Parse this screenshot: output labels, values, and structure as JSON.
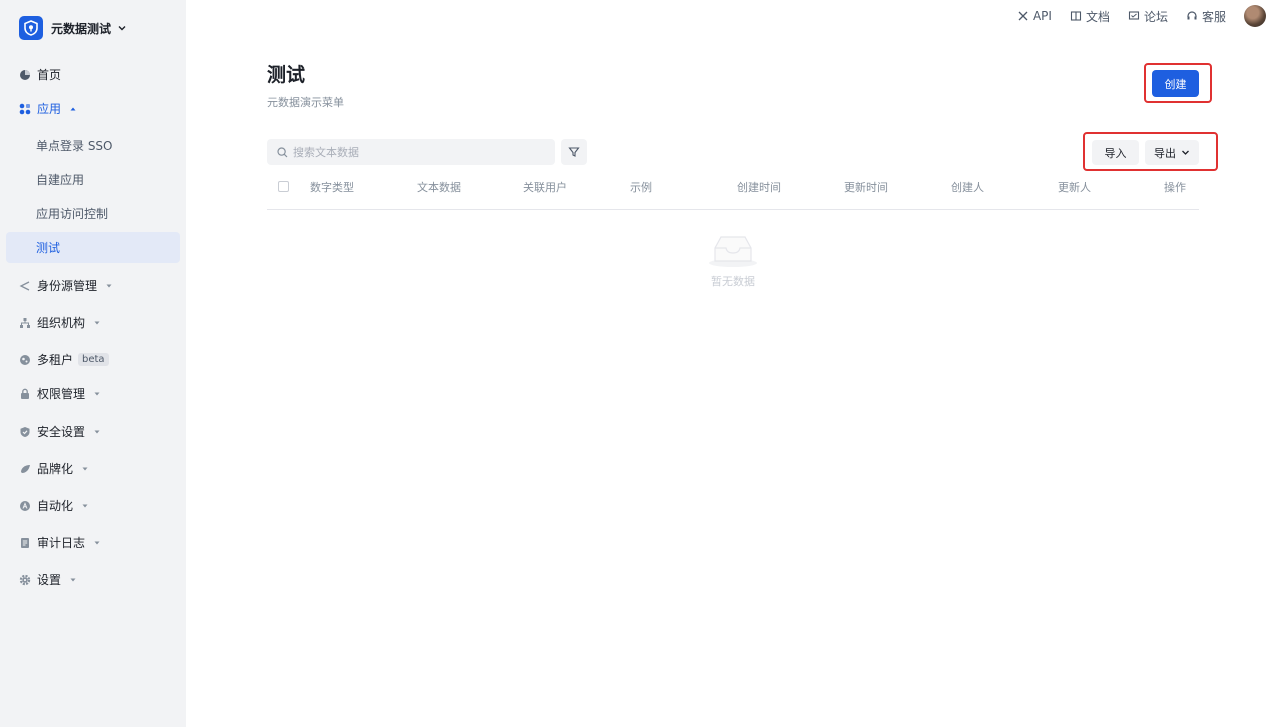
{
  "brand": {
    "name": "元数据测试"
  },
  "topbar": {
    "api": "API",
    "docs": "文档",
    "forum": "论坛",
    "support": "客服"
  },
  "sidebar": {
    "home": "首页",
    "apps": {
      "label": "应用",
      "children": [
        "单点登录 SSO",
        "自建应用",
        "应用访问控制",
        "测试"
      ],
      "selected": "测试"
    },
    "identity_source": "身份源管理",
    "org": "组织机构",
    "tenant": {
      "label": "多租户",
      "badge": "beta"
    },
    "permissions": "权限管理",
    "security": "安全设置",
    "branding": "品牌化",
    "automation": "自动化",
    "audit": "审计日志",
    "settings": "设置"
  },
  "page": {
    "title": "测试",
    "subtitle": "元数据演示菜单",
    "create_label": "创建",
    "import_label": "导入",
    "export_label": "导出"
  },
  "search": {
    "placeholder": "搜索文本数据"
  },
  "table": {
    "columns": [
      "数字类型",
      "文本数据",
      "关联用户",
      "示例",
      "创建时间",
      "更新时间",
      "创建人",
      "更新人",
      "操作"
    ],
    "empty_text": "暂无数据"
  },
  "colors": {
    "accent": "#1e5fe0",
    "highlight_border": "#e03131",
    "sidebar_bg": "#f2f3f5"
  }
}
